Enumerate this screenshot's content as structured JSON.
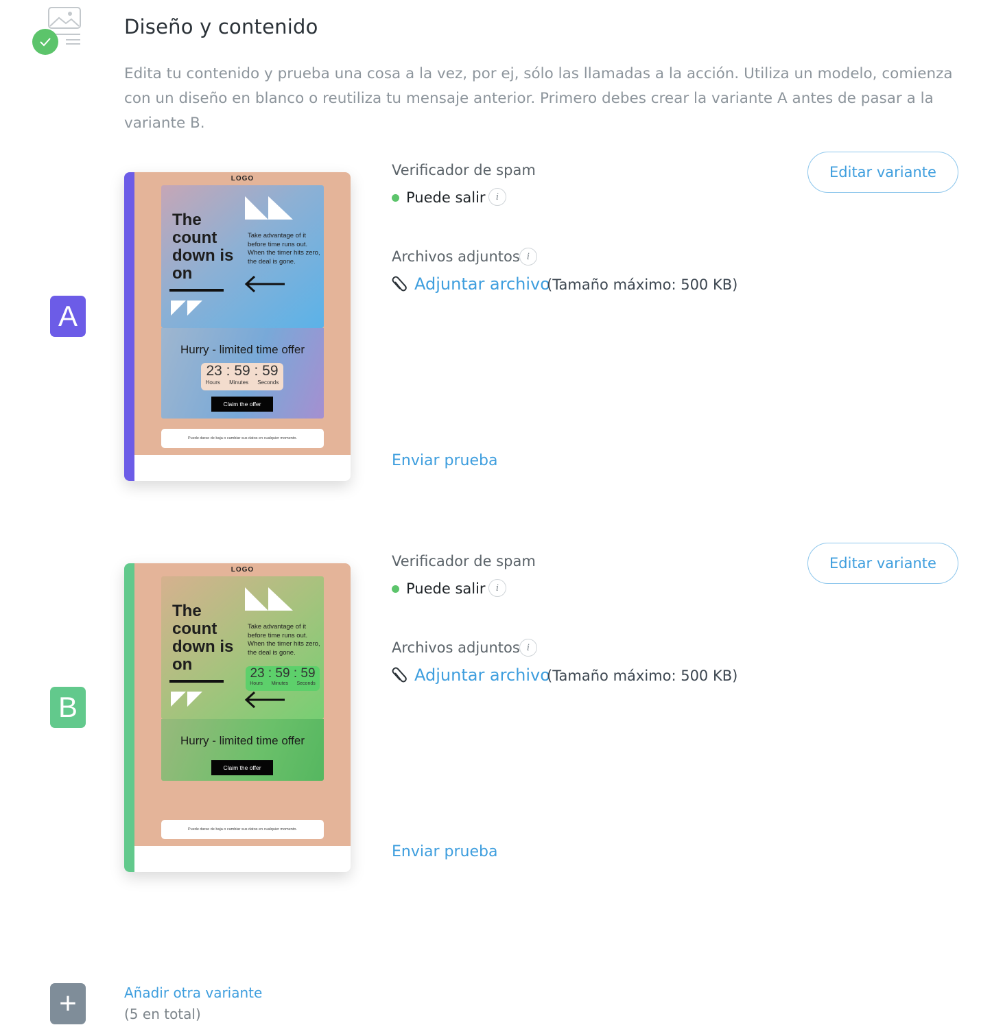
{
  "header": {
    "title": "Diseño y contenido",
    "description": "Edita tu contenido y prueba una cosa a la vez, por ej, sólo las llamadas a la acción. Utiliza un modelo, comienza con un diseño en blanco o reutiliza tu mensaje anterior. Primero debes crear la variante A antes de pasar a la variante B.",
    "icon": "email-design-icon",
    "status_icon": "check-icon"
  },
  "colors": {
    "accent": "#3e9ede",
    "variant_a": "#6c5ce7",
    "variant_b": "#62c98c",
    "success": "#5cc46b",
    "add_badge": "#7f8d99"
  },
  "variants": [
    {
      "letter": "A",
      "spam_label": "Verificador de spam",
      "spam_status": "Puede salir",
      "attachments_label": "Archivos adjuntos",
      "attach_link": "Adjuntar archivo",
      "max_size": "(Tamaño máximo: 500 KB)",
      "send_test": "Enviar prueba",
      "edit_label": "Editar variante",
      "preview": {
        "logo": "LOGO",
        "headline": "The count down is on",
        "copy": "Take advantage of it before time runs out. When the timer hits zero, the deal is gone.",
        "offer": "Hurry - limited time offer",
        "timer": "23 : 59 : 59",
        "unit_hours": "Hours",
        "unit_minutes": "Minutes",
        "unit_seconds": "Seconds",
        "cta": "Claim the offer",
        "footer": "Puede darse de baja o cambiar sus datos en cualquier momento."
      }
    },
    {
      "letter": "B",
      "spam_label": "Verificador de spam",
      "spam_status": "Puede salir",
      "attachments_label": "Archivos adjuntos",
      "attach_link": "Adjuntar archivo",
      "max_size": "(Tamaño máximo: 500 KB)",
      "send_test": "Enviar prueba",
      "edit_label": "Editar variante",
      "preview": {
        "logo": "LOGO",
        "headline": "The count down is on",
        "copy": "Take advantage of it before time runs out. When the timer hits zero, the deal is gone.",
        "offer": "Hurry - limited time offer",
        "timer": "23 : 59 : 59",
        "unit_hours": "Hours",
        "unit_minutes": "Minutes",
        "unit_seconds": "Seconds",
        "cta": "Claim the offer",
        "footer": "Puede darse de baja o cambiar sus datos en cualquier momento."
      }
    }
  ],
  "add_variant": {
    "label": "Añadir otra variante",
    "count": "(5 en total)",
    "symbol": "+"
  },
  "info_symbol": "i"
}
